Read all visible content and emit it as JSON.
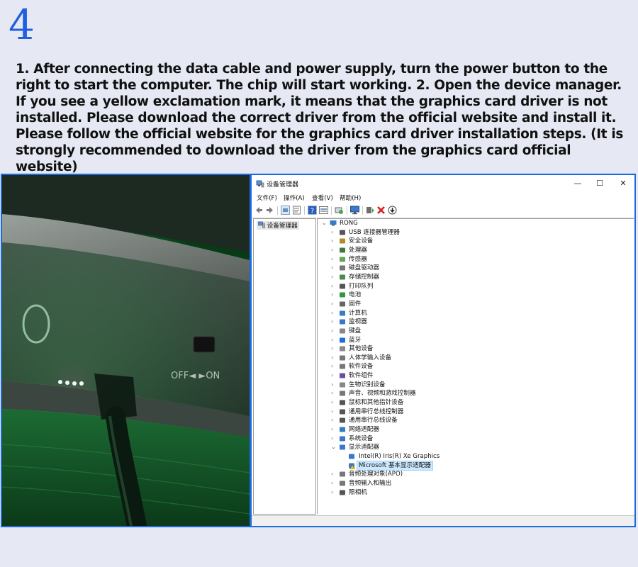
{
  "step_number": "4",
  "instructions": "1. After connecting the data cable and power supply, turn the power button to the right to start the computer. The chip will start working. 2. Open the device manager. If you see a yellow exclamation mark, it means that the graphics card driver is not installed. Please download the correct driver from the official website and install it. Please follow the official website for the graphics card driver installation steps. (It is strongly recommended to download the driver from the graphics card official website)",
  "photo": {
    "switch_label": "OFF◄ ►ON",
    "accent_led": "#22ff55"
  },
  "window": {
    "title": "设备管理器",
    "controls": {
      "minimize": "—",
      "maximize": "☐",
      "close": "✕"
    },
    "menu": [
      "文件(F)",
      "操作(A)",
      "查看(V)",
      "帮助(H)"
    ],
    "toolbar_icons": [
      "back-arrow-icon",
      "forward-arrow-icon",
      "devices-view-icon",
      "properties-icon",
      "help-icon",
      "resources-view-icon",
      "scan-hardware-icon",
      "monitor-icon",
      "update-driver-icon",
      "uninstall-icon",
      "download-icon"
    ],
    "left_pane_item": "设备管理器",
    "tree": {
      "root": "RONG",
      "categories": [
        {
          "label": "USB 连接器管理器",
          "icon": "usb-icon"
        },
        {
          "label": "安全设备",
          "icon": "security-icon"
        },
        {
          "label": "处理器",
          "icon": "processor-icon"
        },
        {
          "label": "传感器",
          "icon": "sensor-icon"
        },
        {
          "label": "磁盘驱动器",
          "icon": "disk-icon"
        },
        {
          "label": "存储控制器",
          "icon": "storage-icon"
        },
        {
          "label": "打印队列",
          "icon": "printer-icon"
        },
        {
          "label": "电池",
          "icon": "battery-icon"
        },
        {
          "label": "固件",
          "icon": "firmware-icon"
        },
        {
          "label": "计算机",
          "icon": "computer-icon"
        },
        {
          "label": "监视器",
          "icon": "monitor-icon"
        },
        {
          "label": "键盘",
          "icon": "keyboard-icon"
        },
        {
          "label": "蓝牙",
          "icon": "bluetooth-icon"
        },
        {
          "label": "其他设备",
          "icon": "other-device-icon"
        },
        {
          "label": "人体学输入设备",
          "icon": "hid-icon"
        },
        {
          "label": "软件设备",
          "icon": "software-device-icon"
        },
        {
          "label": "软件组件",
          "icon": "software-component-icon"
        },
        {
          "label": "生物识别设备",
          "icon": "biometric-icon"
        },
        {
          "label": "声音、视频和游戏控制器",
          "icon": "sound-icon"
        },
        {
          "label": "鼠标和其他指针设备",
          "icon": "mouse-icon"
        },
        {
          "label": "通用串行总线控制器",
          "icon": "usb-controller-icon"
        },
        {
          "label": "通用串行总线设备",
          "icon": "usb-device-icon"
        },
        {
          "label": "网络适配器",
          "icon": "network-icon"
        },
        {
          "label": "系统设备",
          "icon": "system-icon"
        },
        {
          "label": "显示适配器",
          "icon": "display-adapter-icon",
          "expanded": true
        },
        {
          "label": "音频处理对象(APO)",
          "icon": "audio-processing-icon"
        },
        {
          "label": "音频输入和输出",
          "icon": "audio-io-icon"
        },
        {
          "label": "照相机",
          "icon": "camera-icon"
        }
      ],
      "display_children": [
        {
          "label": "Intel(R) Iris(R) Xe Graphics",
          "icon": "display-adapter-icon"
        },
        {
          "label": "Microsoft 基本显示适配器",
          "icon": "warning-display-icon",
          "selected": true
        }
      ]
    }
  }
}
